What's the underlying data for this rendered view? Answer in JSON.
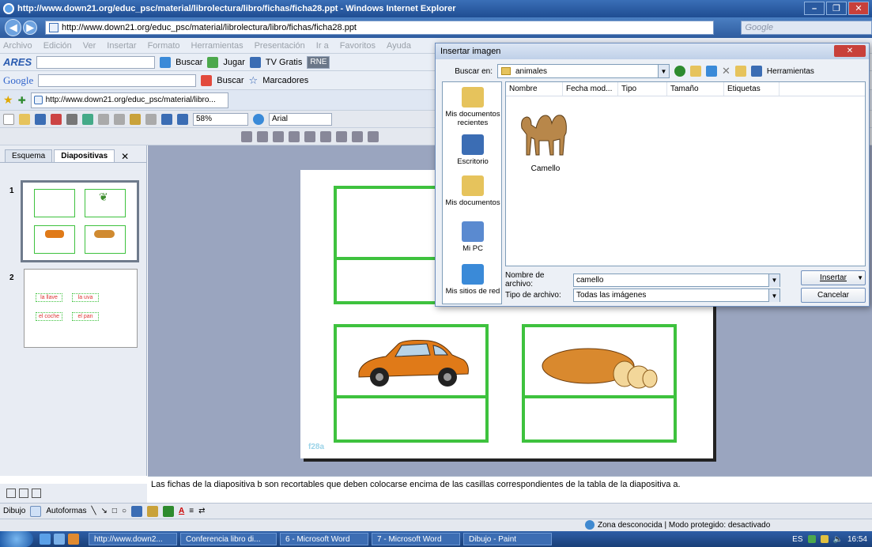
{
  "window": {
    "title": "http://www.down21.org/educ_psc/material/librolectura/libro/fichas/ficha28.ppt - Windows Internet Explorer",
    "address": "http://www.down21.org/educ_psc/material/librolectura/libro/fichas/ficha28.ppt",
    "search_placeholder": "Google"
  },
  "menu": [
    "Archivo",
    "Edición",
    "Ver",
    "Insertar",
    "Formato",
    "Herramientas",
    "Presentación",
    "Ir a",
    "Favoritos",
    "Ayuda"
  ],
  "ares_bar": {
    "logo": "ARES",
    "buscar": "Buscar",
    "jugar": "Jugar",
    "tv": "TV Gratis",
    "rne": "RNE"
  },
  "google_bar": {
    "logo": "Google",
    "buscar": "Buscar",
    "marcadores": "Marcadores"
  },
  "tab": {
    "label": "http://www.down21.org/educ_psc/material/libro..."
  },
  "ppt_toolbar": {
    "zoom": "58%",
    "font": "Arial"
  },
  "left_pane": {
    "tab_outline": "Esquema",
    "tab_slides": "Diapositivas",
    "slide1_number": "1",
    "slide2_number": "2",
    "slide2_labels": [
      "la llave",
      "la uva",
      "el coche",
      "el pan"
    ]
  },
  "slide": {
    "watermark": "f28a"
  },
  "notes": "Las fichas de la diapositiva b son recortables que deben colocarse encima de las casillas correspondientes de la tabla de la diapositiva a.",
  "drawbar": {
    "dibujo": "Dibujo",
    "autoformas": "Autoformas"
  },
  "status": {
    "zone": "Zona desconocida | Modo protegido: desactivado"
  },
  "taskbar": {
    "tasks": [
      "http://www.down2...",
      "Conferencia libro di...",
      "6 - Microsoft Word",
      "7 - Microsoft Word",
      "Dibujo - Paint"
    ],
    "lang": "ES",
    "time": "16:54"
  },
  "dialog": {
    "title": "Insertar imagen",
    "lookin_label": "Buscar en:",
    "lookin_value": "animales",
    "tools_label": "Herramientas",
    "places": [
      "Mis documentos recientes",
      "Escritorio",
      "Mis documentos",
      "Mi PC",
      "Mis sitios de red"
    ],
    "columns": [
      "Nombre",
      "Fecha mod...",
      "Tipo",
      "Tamaño",
      "Etiquetas"
    ],
    "file_name_label": "Nombre de archivo:",
    "file_name_value": "camello",
    "file_type_label": "Tipo de archivo:",
    "file_type_value": "Todas las imágenes",
    "insert_label": "Insertar",
    "cancel_label": "Cancelar",
    "file_item": "Camello"
  }
}
